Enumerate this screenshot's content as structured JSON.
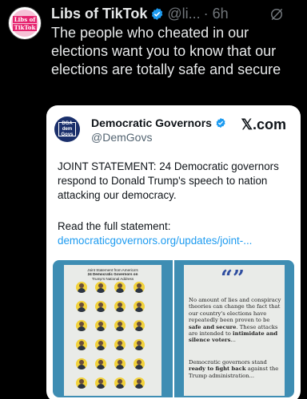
{
  "post": {
    "avatar_text_line1": "Libs of",
    "avatar_text_line2": "TikTok",
    "author_name": "Libs of TikTok",
    "handle": "@li...",
    "time": "· 6h",
    "text": "The people who cheated in our elections want you to know that our elections are totally safe and secure"
  },
  "embed": {
    "logo_line1": "DGA",
    "logo_line2": "dem",
    "logo_line3": "Govs",
    "name": "Democratic Governors",
    "handle": "@DemGovs",
    "source": "𝕏.com",
    "body": "JOINT STATEMENT: 24 Democratic governors respond to Donald Trump's speech to nation attacking our democracy.",
    "read_more": "Read the full statement:",
    "link": "democraticgovernors.org/updates/joint-...",
    "image_left_title_line1": "Joint Statement from America's",
    "image_left_title_line2": "24 Democratic Governors on",
    "image_left_title_line3": "Trump's National Address",
    "image_right_quote": "“”",
    "image_right_p1_a": "No amount of lies and conspiracy theories can change the fact that our country's elections have repeatedly been proven to be ",
    "image_right_p1_b": "safe and secure",
    "image_right_p1_c": ". These attacks are intended to ",
    "image_right_p1_d": "intimidate and silence voters",
    "image_right_p1_e": "...",
    "image_right_p2_a": "Democratic governors stand ",
    "image_right_p2_b": "ready to fight back",
    "image_right_p2_c": " against the Trump administration..."
  },
  "colors": {
    "background": "#000000",
    "verified_blue": "#1d9bf0",
    "link_blue": "#1d9bf0",
    "muted": "#71767b",
    "image_bg": "#3e8db3"
  },
  "icons": [
    "verified-badge-icon",
    "grok-icon",
    "x-logo-icon"
  ]
}
